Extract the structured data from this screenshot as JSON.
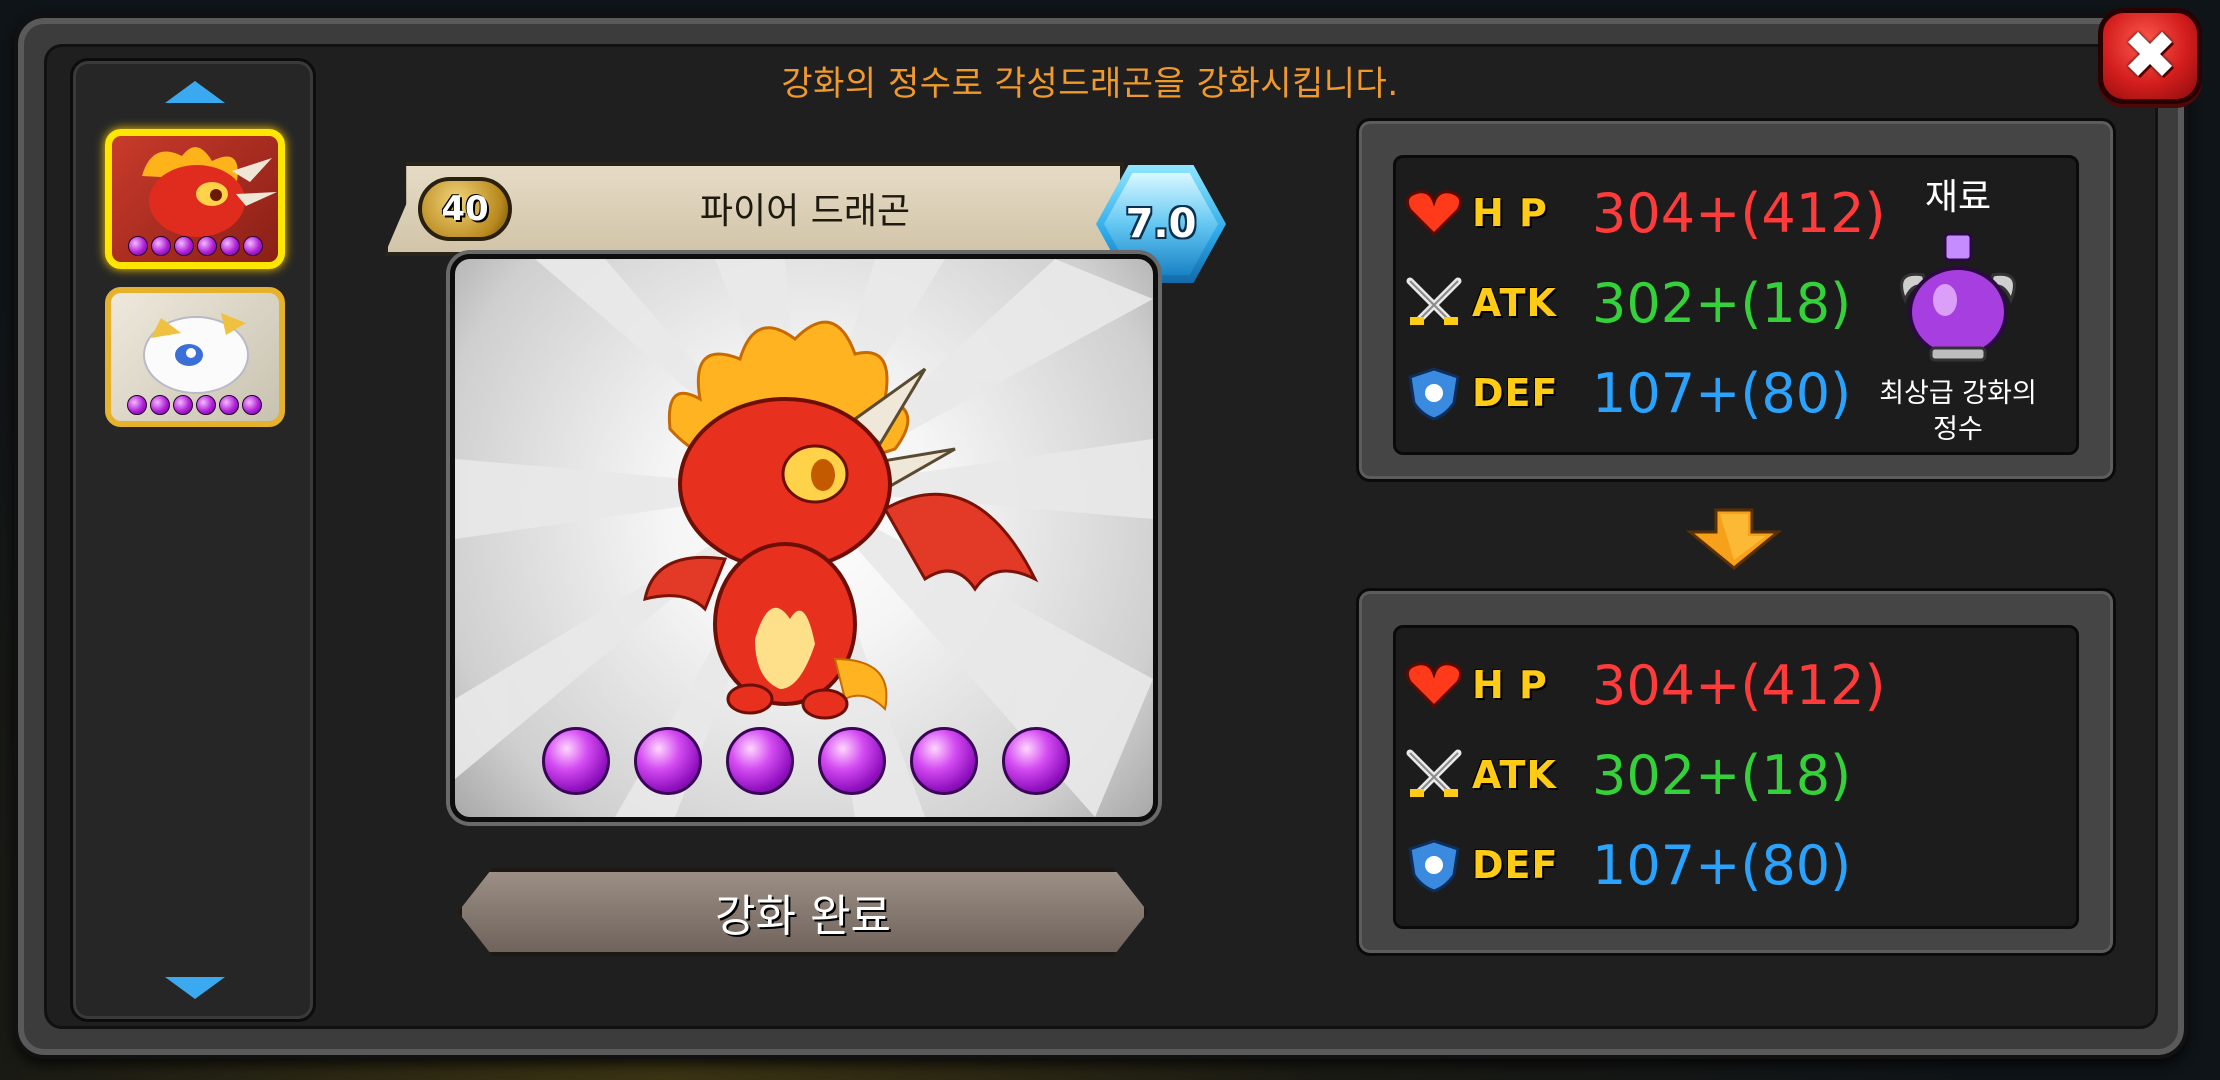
{
  "header": {
    "instruction": "강화의 정수로 각성드래곤을 강화시킵니다."
  },
  "close_button": {
    "label": "✖"
  },
  "dragon_list": {
    "items": [
      {
        "name": "fire-dragon",
        "selected": true,
        "orbs": 6
      },
      {
        "name": "white-dragon",
        "selected": false,
        "orbs": 6
      }
    ]
  },
  "card": {
    "level": "40",
    "name": "파이어 드래곤",
    "grade": "7.0",
    "orb_count": 6
  },
  "action": {
    "complete_label": "강화 완료"
  },
  "stats_before": {
    "hp": {
      "label": "H P",
      "value": "304+(412)"
    },
    "atk": {
      "label": "ATK",
      "value": "302+(18)"
    },
    "def": {
      "label": "DEF",
      "value": "107+(80)"
    }
  },
  "material": {
    "title": "재료",
    "name_line1": "최상급 강화의",
    "name_line2": "정수"
  },
  "stats_after": {
    "hp": {
      "label": "H P",
      "value": "304+(412)"
    },
    "atk": {
      "label": "ATK",
      "value": "302+(18)"
    },
    "def": {
      "label": "DEF",
      "value": "107+(80)"
    }
  },
  "colors": {
    "hp": "#ff3b3b",
    "atk": "#35d13a",
    "def": "#2aa3ff",
    "accent": "#f09a2c"
  },
  "icons": [
    "heart-icon",
    "crossed-swords-icon",
    "shield-icon",
    "potion-icon",
    "close-icon"
  ]
}
